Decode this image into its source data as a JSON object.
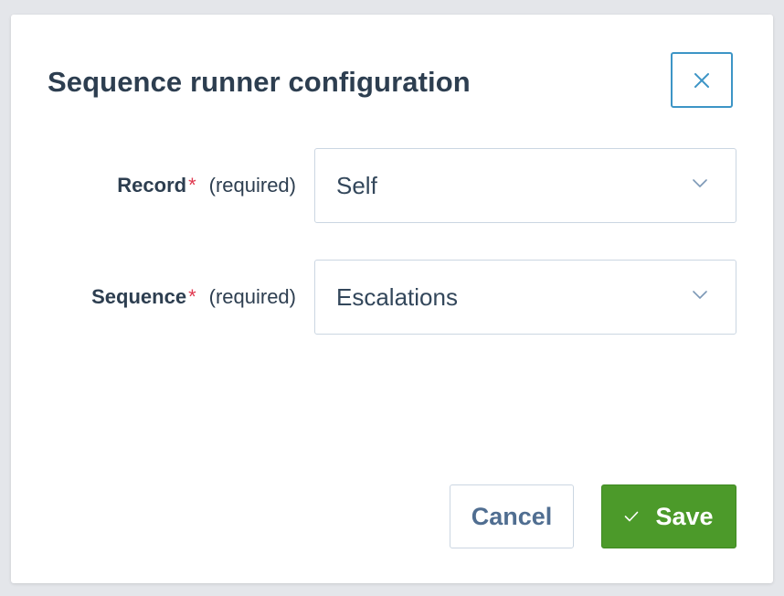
{
  "dialog": {
    "title": "Sequence runner configuration",
    "close_icon": "close-icon"
  },
  "fields": [
    {
      "label": "Record",
      "required_mark": "*",
      "required_text": "(required)",
      "value": "Self",
      "icon": "chevron-down-icon"
    },
    {
      "label": "Sequence",
      "required_mark": "*",
      "required_text": "(required)",
      "value": "Escalations",
      "icon": "chevron-down-icon"
    }
  ],
  "footer": {
    "cancel_label": "Cancel",
    "save_label": "Save",
    "save_icon": "check-icon"
  },
  "colors": {
    "title": "#2d3e50",
    "required": "#e0384f",
    "close_border": "#3d95c6",
    "save_background": "#4c9a2a",
    "cancel_text": "#506e91"
  }
}
